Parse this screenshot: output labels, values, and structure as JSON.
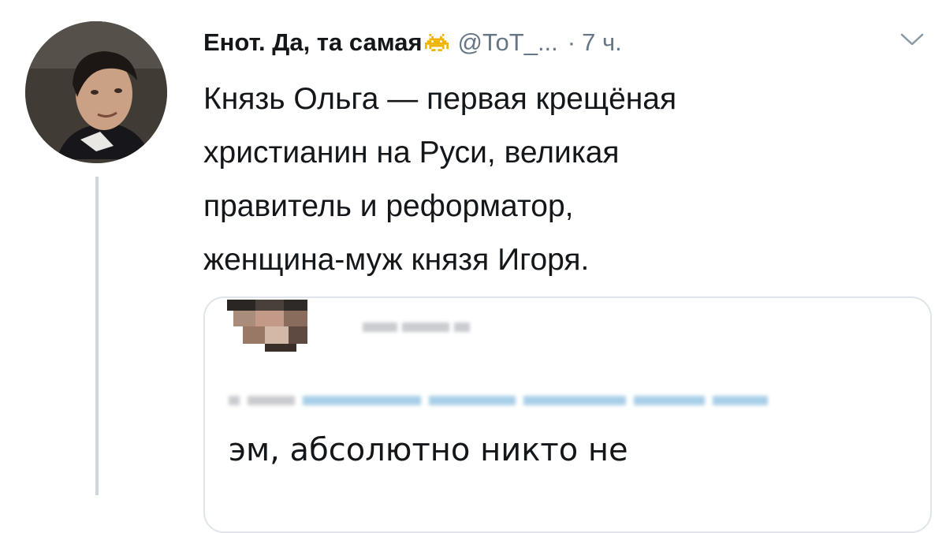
{
  "tweet": {
    "display_name": "Енот. Да, та самая",
    "name_emoji": "space-invader-icon",
    "handle": "@ТоТ_...",
    "separator": "·",
    "time": "7 ч.",
    "text_lines": [
      "Князь Ольга — первая крещёная",
      "христианин на Руси, великая",
      "правитель и реформатор,",
      "женщина-муж князя Игоря."
    ]
  },
  "quoted_tweet": {
    "text": "эм, абсолютно никто не"
  },
  "colors": {
    "text_primary": "#14171a",
    "text_secondary": "#657786",
    "thread_line": "#cdd6dd",
    "quote_border": "#dfe5ea",
    "emoji_yellow": "#f0b400"
  }
}
